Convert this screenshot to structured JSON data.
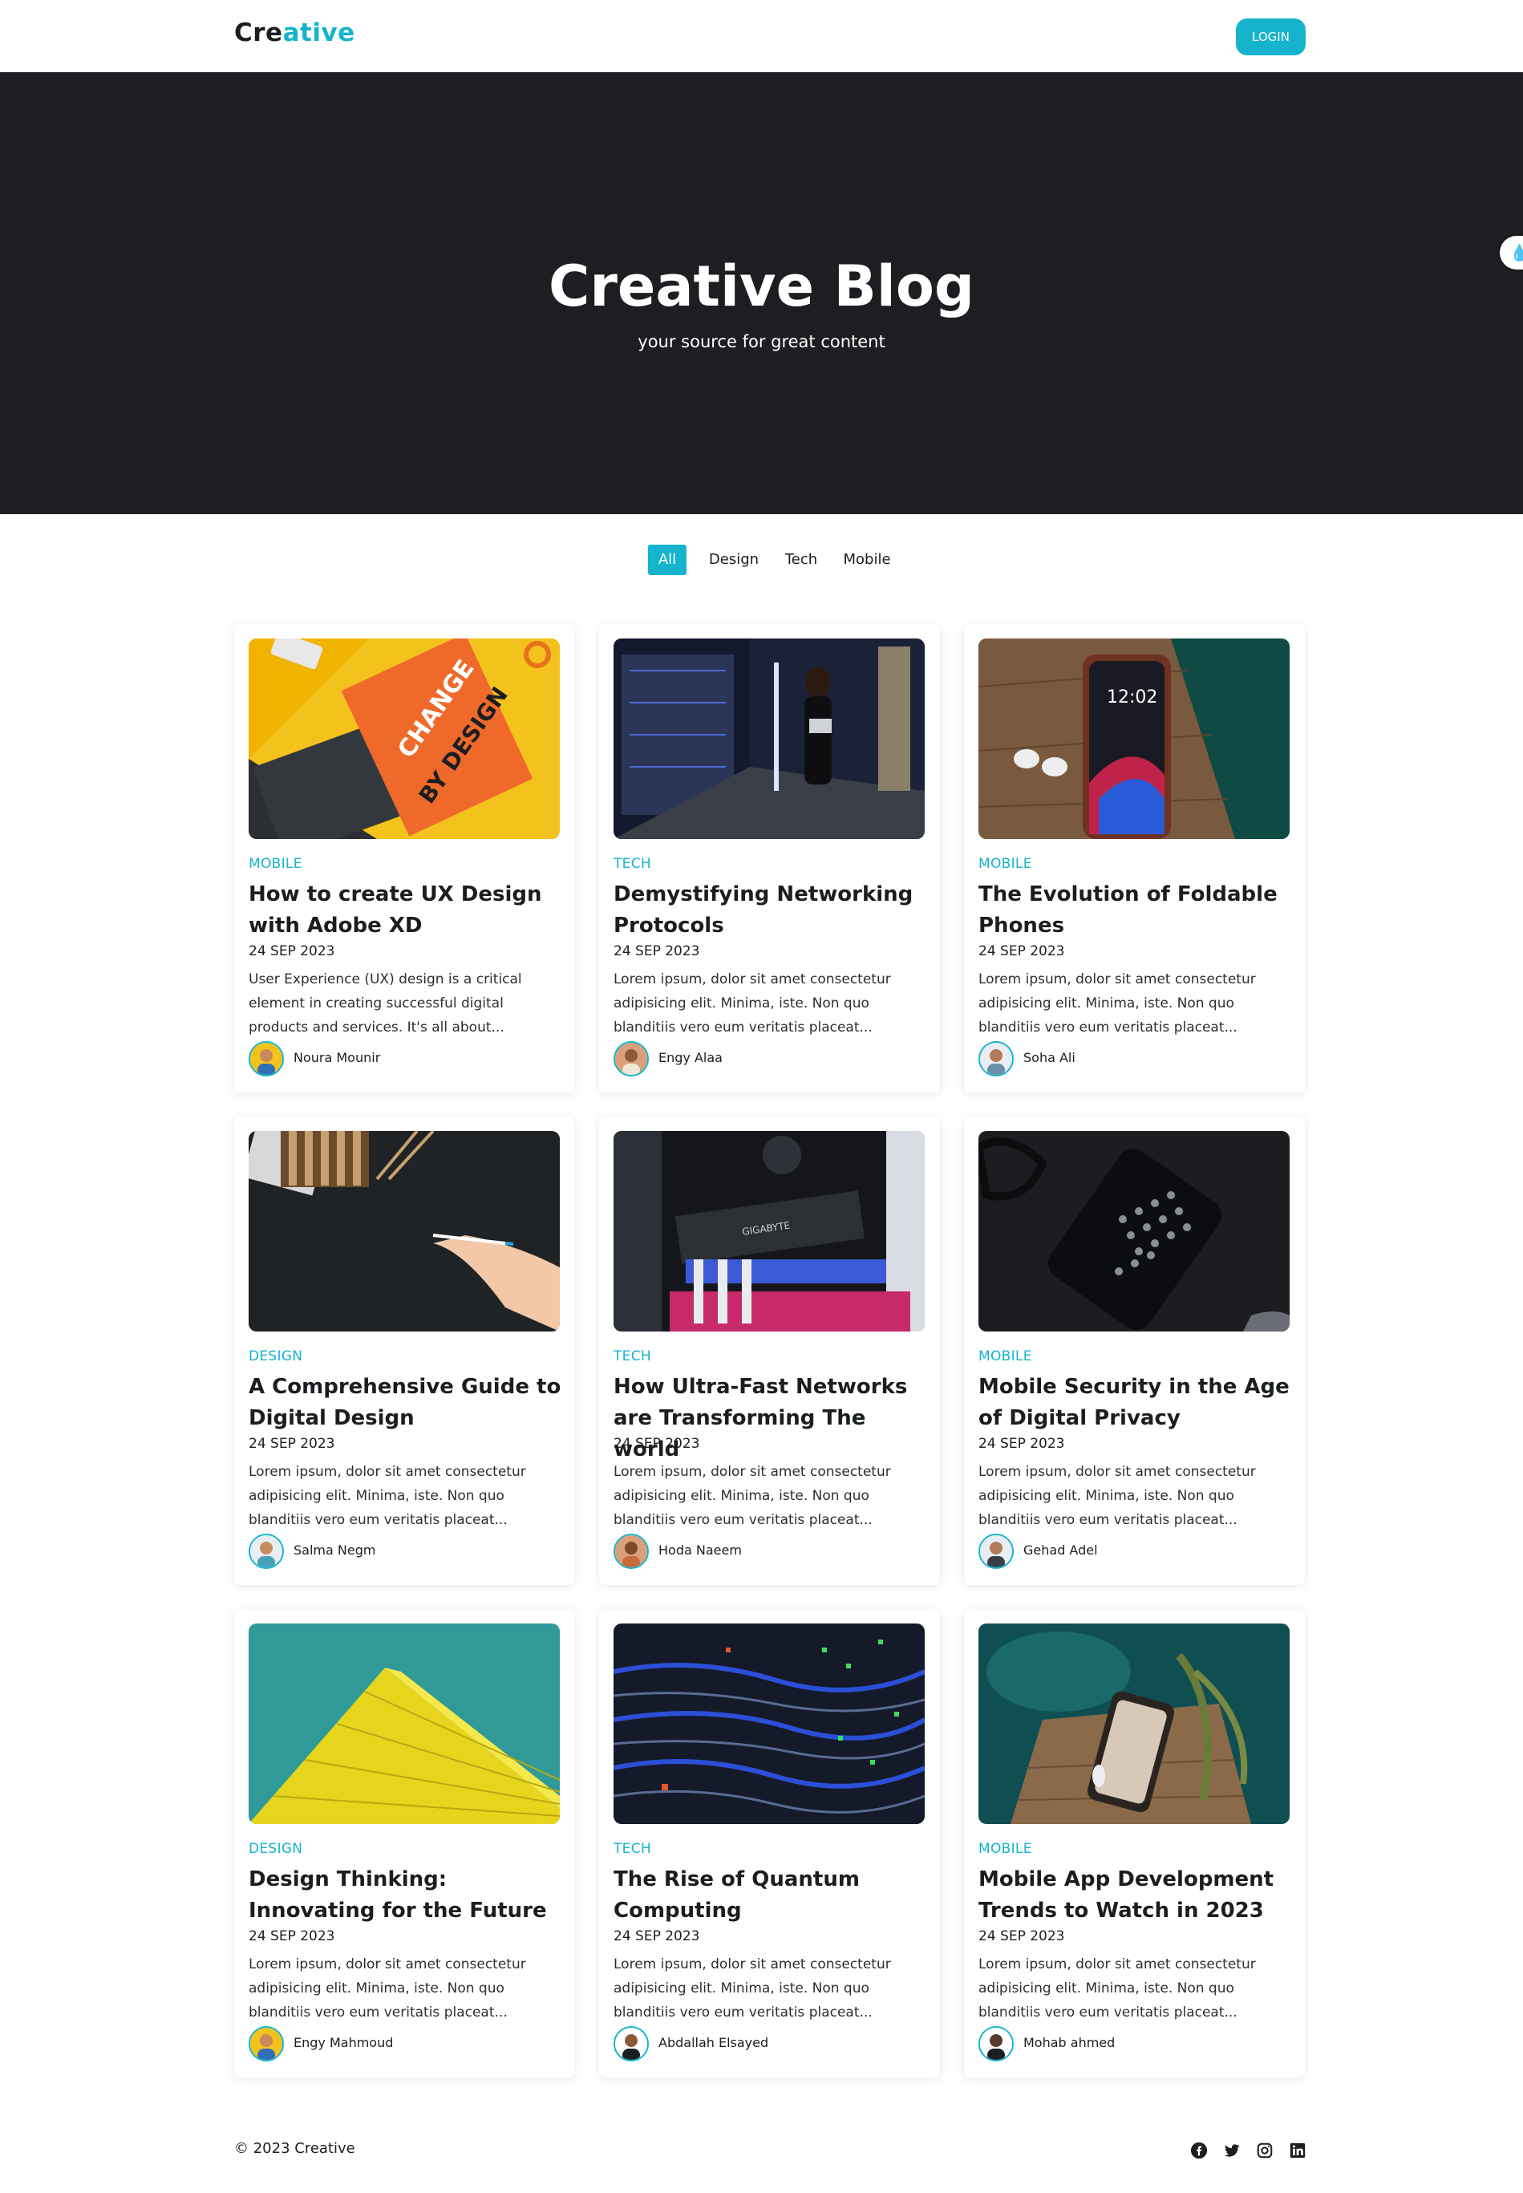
{
  "header": {
    "logo_part1": "Cre",
    "logo_part2": "ative",
    "login_label": "LOGIN",
    "accent_color": "#15b4cc"
  },
  "hero": {
    "title": "Creative Blog",
    "subtitle": "your source for great content",
    "background_color": "#1c1e21",
    "side_widget_icon": "drop-icon"
  },
  "filters": {
    "items": [
      "All",
      "Design",
      "Tech",
      "Mobile"
    ],
    "active": "All"
  },
  "posts": [
    {
      "category": "MOBILE",
      "title": "How to create UX Design with Adobe XD",
      "date": "24 SEP 2023",
      "excerpt": "User Experience (UX) design is a critical element in creating successful digital products and services. It's all about...",
      "author": "Noura Mounir",
      "image": "book-change-by-design"
    },
    {
      "category": "TECH",
      "title": "Demystifying Networking Protocols",
      "date": "24 SEP 2023",
      "excerpt": "Lorem ipsum, dolor sit amet consectetur adipisicing elit. Minima, iste. Non quo blanditiis vero eum veritatis placeat...",
      "author": "Engy Alaa",
      "image": "woman-in-server-room"
    },
    {
      "category": "MOBILE",
      "title": "The Evolution of Foldable Phones",
      "date": "24 SEP 2023",
      "excerpt": "Lorem ipsum, dolor sit amet consectetur adipisicing elit. Minima, iste. Non quo blanditiis vero eum veritatis placeat...",
      "author": "Soha Ali",
      "image": "phone-and-earbuds"
    },
    {
      "category": "DESIGN",
      "title": "A Comprehensive Guide to Digital Design",
      "date": "24 SEP 2023",
      "excerpt": "Lorem ipsum, dolor sit amet consectetur adipisicing elit. Minima, iste. Non quo blanditiis vero eum veritatis placeat...",
      "author": "Salma Negm",
      "image": "hand-with-pencil"
    },
    {
      "category": "TECH",
      "title": "How Ultra-Fast Networks are Transforming The world",
      "date": "24 SEP 2023",
      "excerpt": "Lorem ipsum, dolor sit amet consectetur adipisicing elit. Minima, iste. Non quo blanditiis vero eum veritatis placeat...",
      "author": "Hoda Naeem",
      "image": "pc-graphics-card"
    },
    {
      "category": "MOBILE",
      "title": "Mobile Security in the Age of Digital Privacy",
      "date": "24 SEP 2023",
      "excerpt": "Lorem ipsum, dolor sit amet consectetur adipisicing elit. Minima, iste. Non quo blanditiis vero eum veritatis placeat...",
      "author": "Gehad Adel",
      "image": "phone-and-glasses"
    },
    {
      "category": "DESIGN",
      "title": "Design Thinking: Innovating for the Future",
      "date": "24 SEP 2023",
      "excerpt": "Lorem ipsum, dolor sit amet consectetur adipisicing elit. Minima, iste. Non quo blanditiis vero eum veritatis placeat...",
      "author": "Engy Mahmoud",
      "image": "yellow-building"
    },
    {
      "category": "TECH",
      "title": "The Rise of Quantum Computing",
      "date": "24 SEP 2023",
      "excerpt": "Lorem ipsum, dolor sit amet consectetur adipisicing elit. Minima, iste. Non quo blanditiis vero eum veritatis placeat...",
      "author": "Abdallah Elsayed",
      "image": "network-cables"
    },
    {
      "category": "MOBILE",
      "title": "Mobile App Development Trends to Watch in 2023",
      "date": "24 SEP 2023",
      "excerpt": "Lorem ipsum, dolor sit amet consectetur adipisicing elit. Minima, iste. Non quo blanditiis vero eum veritatis placeat...",
      "author": "Mohab ahmed",
      "image": "phone-on-wood"
    }
  ],
  "footer": {
    "copyright": "© 2023 Creative",
    "social_icons": [
      "facebook-icon",
      "twitter-icon",
      "instagram-icon",
      "linkedin-icon"
    ]
  }
}
